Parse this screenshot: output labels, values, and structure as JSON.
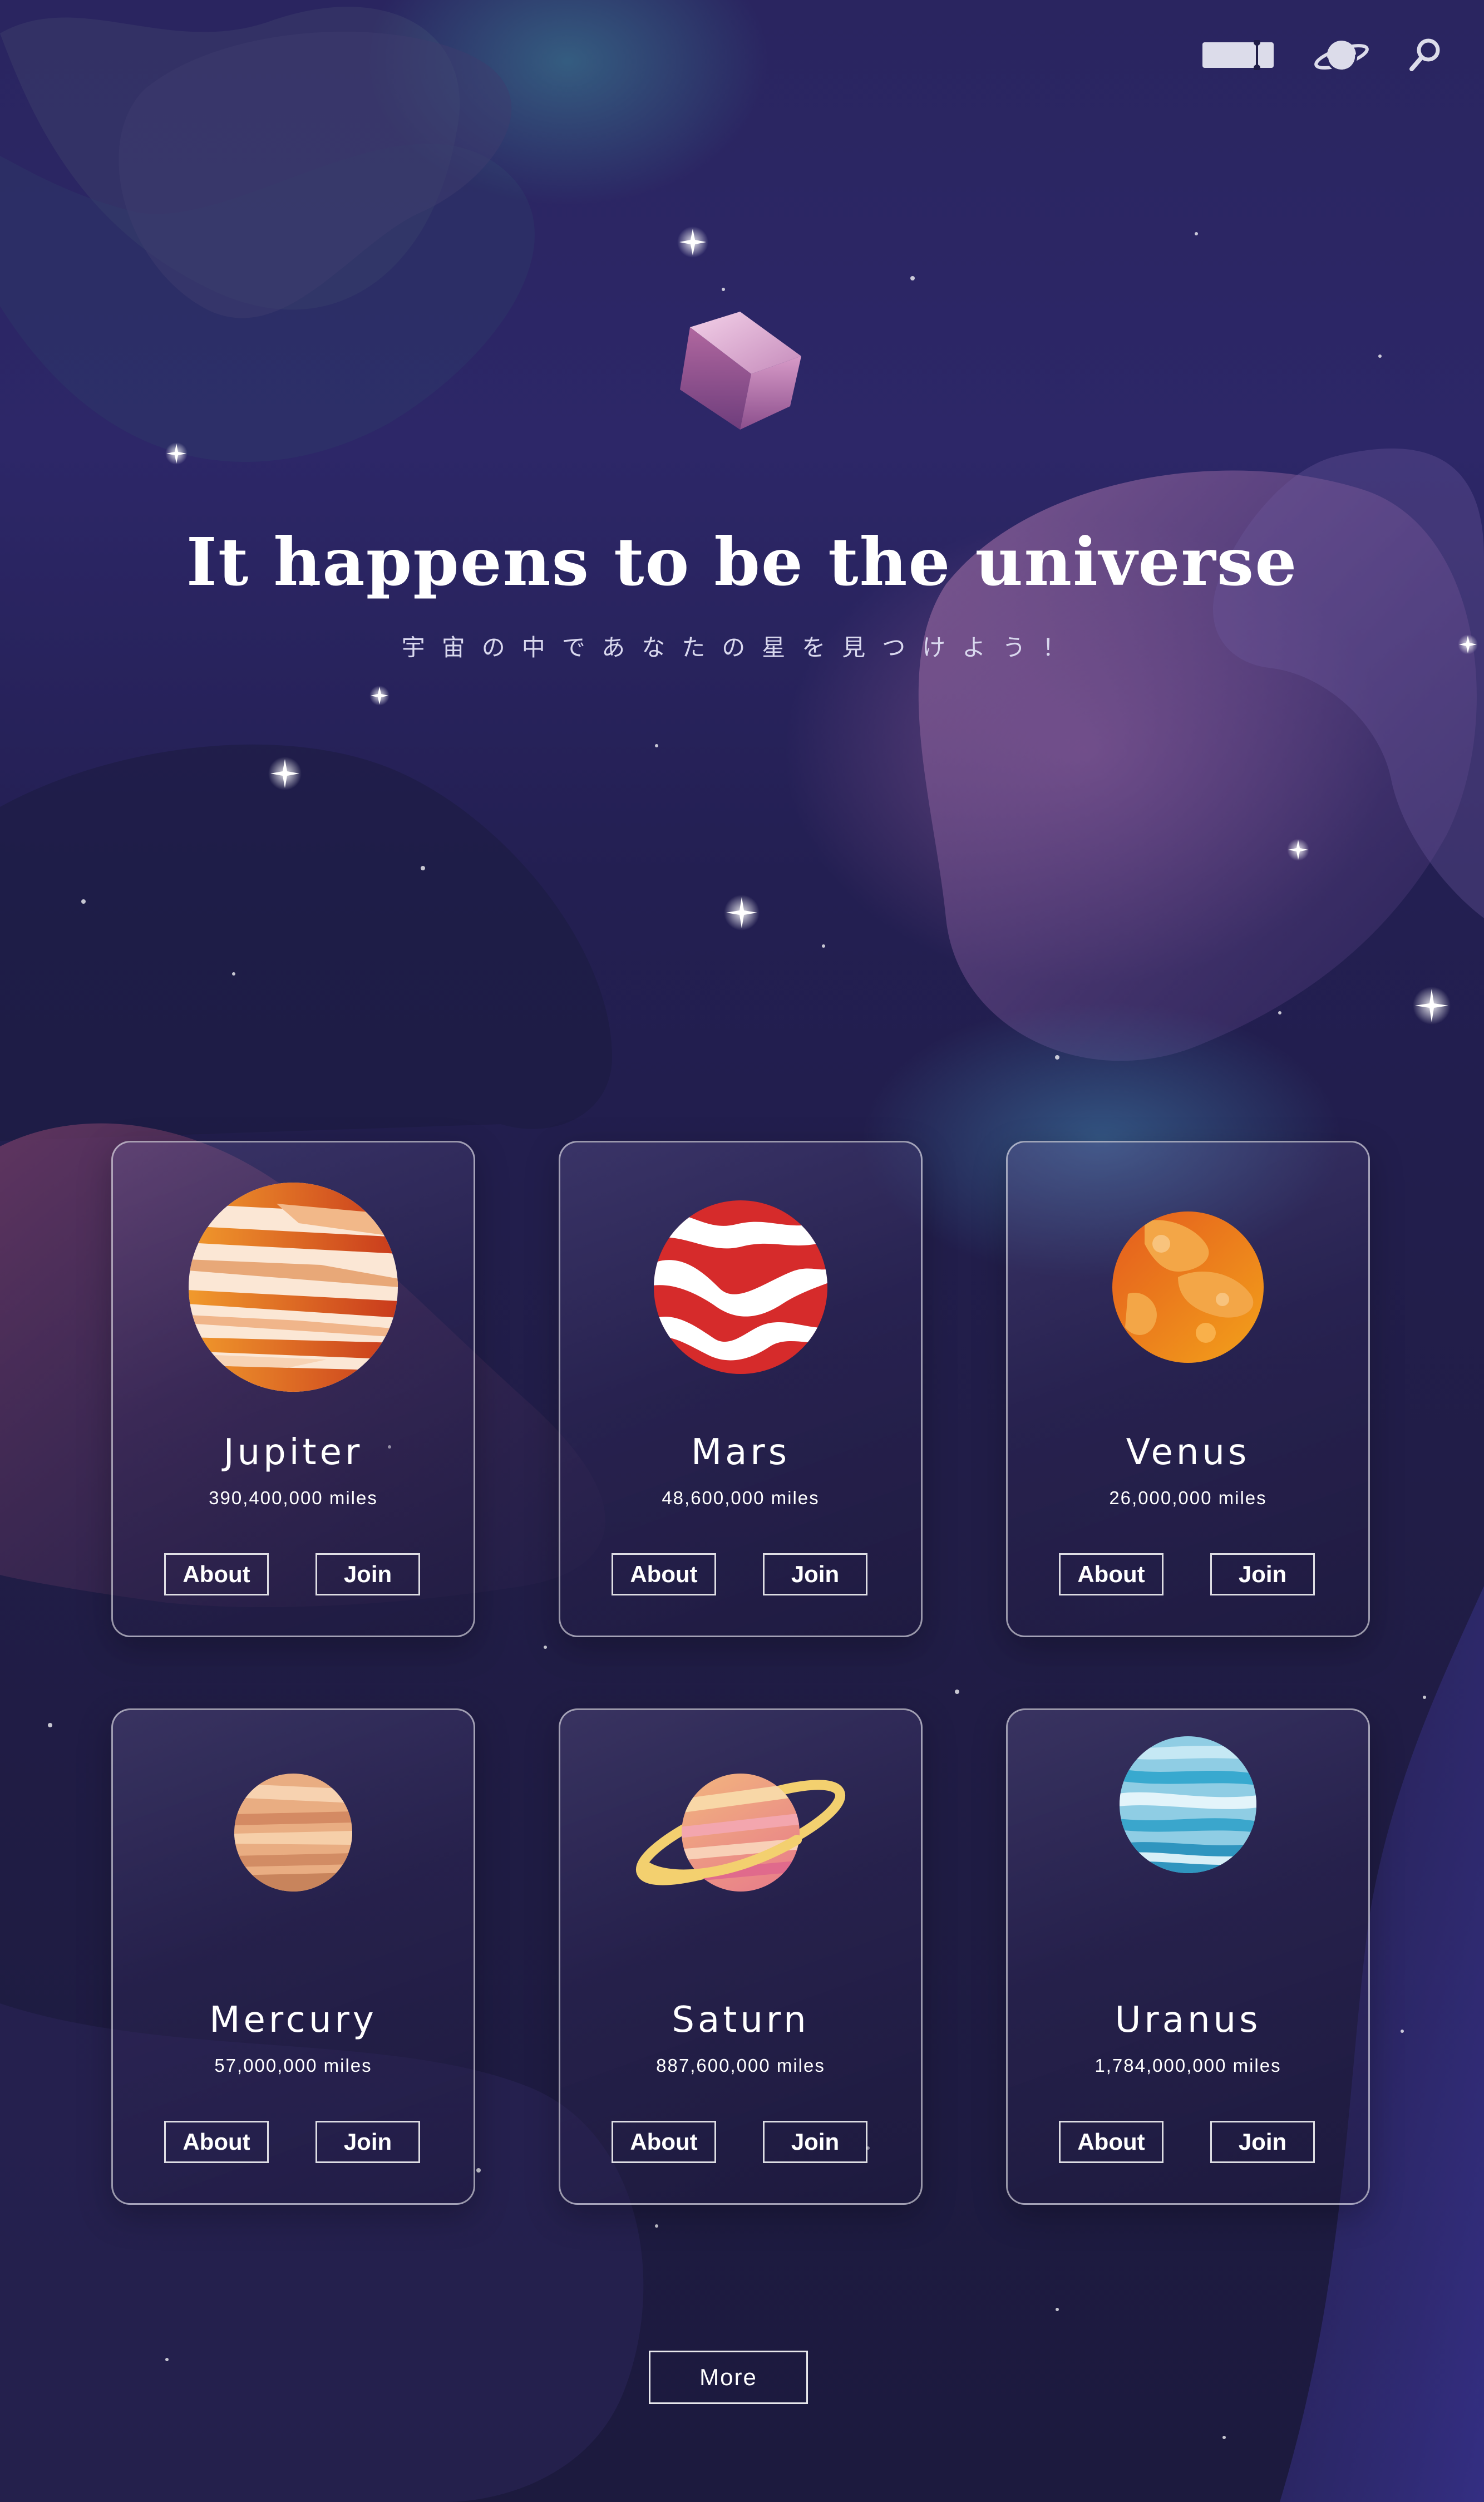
{
  "nav": {
    "icons": [
      "ticket-icon",
      "planet-icon",
      "search-icon"
    ]
  },
  "hero": {
    "title": "It happens to be the universe",
    "subtitle": "宇宙の中であなたの星を見つけよう！"
  },
  "cards": [
    {
      "name": "Jupiter",
      "distance": "390,400,000 miles",
      "about_label": "About",
      "join_label": "Join",
      "icon": "jupiter-icon"
    },
    {
      "name": "Mars",
      "distance": "48,600,000 miles",
      "about_label": "About",
      "join_label": "Join",
      "icon": "mars-icon"
    },
    {
      "name": "Venus",
      "distance": "26,000,000 miles",
      "about_label": "About",
      "join_label": "Join",
      "icon": "venus-icon"
    },
    {
      "name": "Mercury",
      "distance": "57,000,000 miles",
      "about_label": "About",
      "join_label": "Join",
      "icon": "mercury-icon"
    },
    {
      "name": "Saturn",
      "distance": "887,600,000 miles",
      "about_label": "About",
      "join_label": "Join",
      "icon": "saturn-icon"
    },
    {
      "name": "Uranus",
      "distance": "1,784,000,000 miles",
      "about_label": "About",
      "join_label": "Join",
      "icon": "uranus-icon"
    }
  ],
  "more_label": "More",
  "colors": {
    "background": "#1a1838",
    "card_border": "#ffffff",
    "text": "#ffffff"
  }
}
